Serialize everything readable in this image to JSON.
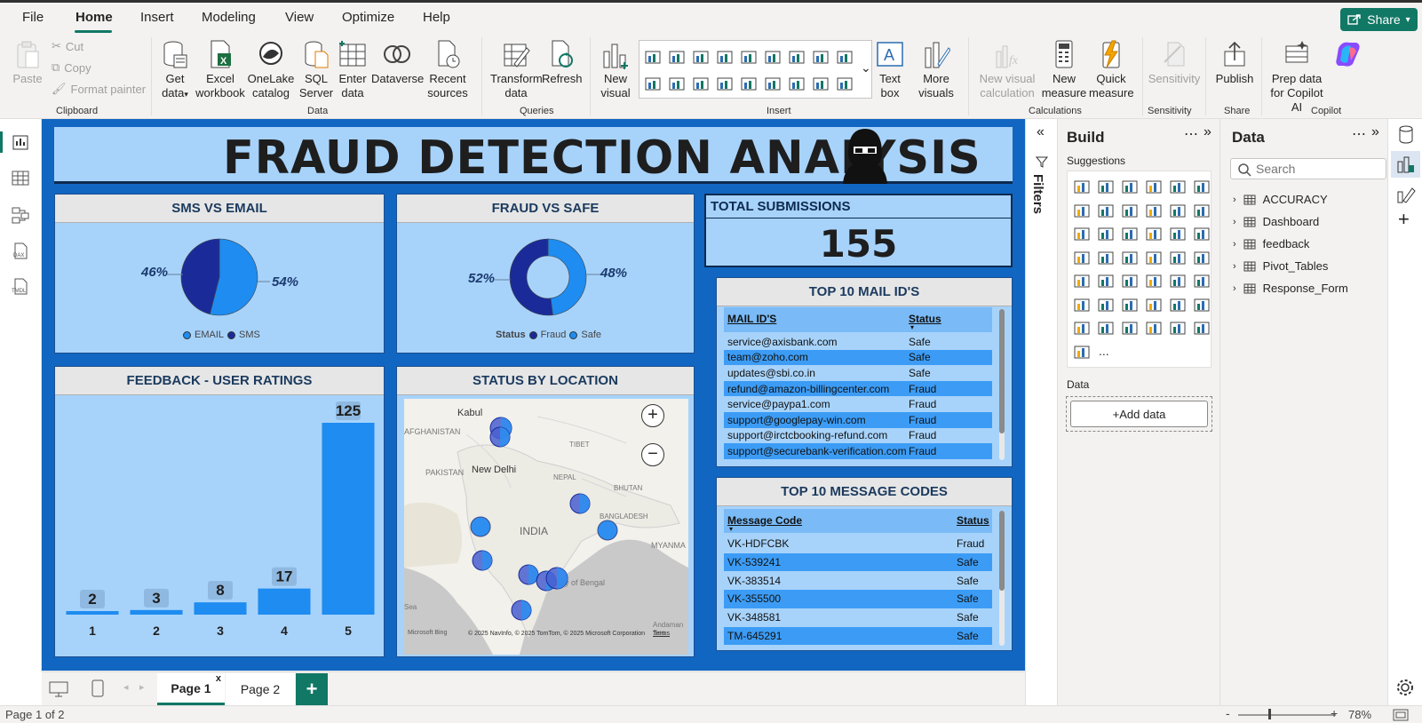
{
  "menu": {
    "items": [
      "File",
      "Home",
      "Insert",
      "Modeling",
      "View",
      "Optimize",
      "Help"
    ],
    "share": "Share"
  },
  "ribbon": {
    "clipboard": {
      "paste": "Paste",
      "cut": "Cut",
      "copy": "Copy",
      "format_painter": "Format painter",
      "group": "Clipboard"
    },
    "data": {
      "get_data": "Get data",
      "excel": "Excel workbook",
      "onelake": "OneLake catalog",
      "sql": "SQL Server",
      "enter_data": "Enter data",
      "dataverse": "Dataverse",
      "recent": "Recent sources",
      "group": "Data"
    },
    "queries": {
      "transform": "Transform data",
      "refresh": "Refresh",
      "group": "Queries"
    },
    "insert": {
      "new_visual": "New visual",
      "text_box": "Text box",
      "more_visuals": "More visuals",
      "group": "Insert"
    },
    "calculations": {
      "new_visual_calc": "New visual calculation",
      "new_measure": "New measure",
      "quick_measure": "Quick measure",
      "group": "Calculations"
    },
    "sensitivity": {
      "label": "Sensitivity",
      "group": "Sensitivity"
    },
    "share": {
      "publish": "Publish",
      "group": "Share"
    },
    "copilot": {
      "prep": "Prep data for Copilot AI",
      "group": "Copilot"
    }
  },
  "report": {
    "title": "FRAUD DETECTION ANALYSIS",
    "sms_email": {
      "title": "SMS VS EMAIL",
      "email_pct": "46%",
      "sms_pct": "54%",
      "legend": [
        "EMAIL",
        "SMS"
      ],
      "values": {
        "EMAIL": 46,
        "SMS": 54
      }
    },
    "fraud_safe": {
      "title": "FRAUD VS SAFE",
      "fraud_pct": "52%",
      "safe_pct": "48%",
      "legend_title": "Status",
      "legend": [
        "Fraud",
        "Safe"
      ],
      "values": {
        "Fraud": 52,
        "Safe": 48
      }
    },
    "total": {
      "title": "TOTAL SUBMISSIONS",
      "value": "155"
    },
    "mail_ids": {
      "title": "TOP 10 MAIL ID'S",
      "headers": [
        "MAIL ID'S",
        "Status"
      ],
      "rows": [
        [
          "service@axisbank.com",
          "Safe"
        ],
        [
          "team@zoho.com",
          "Safe"
        ],
        [
          "updates@sbi.co.in",
          "Safe"
        ],
        [
          "refund@amazon-billingcenter.com",
          "Fraud"
        ],
        [
          "service@paypa1.com",
          "Fraud"
        ],
        [
          "support@googlepay-win.com",
          "Fraud"
        ],
        [
          "support@irctcbooking-refund.com",
          "Fraud"
        ],
        [
          "support@securebank-verification.com",
          "Fraud"
        ]
      ]
    },
    "message_codes": {
      "title": "TOP 10 MESSAGE CODES",
      "headers": [
        "Message Code",
        "Status"
      ],
      "rows": [
        [
          "VK-HDFCBK",
          "Fraud"
        ],
        [
          "VK-539241",
          "Safe"
        ],
        [
          "VK-383514",
          "Safe"
        ],
        [
          "VK-355500",
          "Safe"
        ],
        [
          "VK-348581",
          "Safe"
        ],
        [
          "TM-645291",
          "Safe"
        ]
      ]
    },
    "map": {
      "title": "STATUS BY LOCATION",
      "labels": [
        "Kabul",
        "AFGHANISTAN",
        "TIBET",
        "PAKISTAN",
        "New Delhi",
        "NEPAL",
        "BHUTAN",
        "INDIA",
        "BANGLADESH",
        "MYANMA",
        "Bay of Bengal",
        "Andaman Sea",
        "Sea"
      ],
      "credit": "© 2025 NavInfo, © 2025 TomTom, © 2025 Microsoft Corporation",
      "terms": "Terms",
      "bing": "Microsoft Bing"
    }
  },
  "chart_data": {
    "type": "bar",
    "title": "FEEDBACK - USER RATINGS",
    "categories": [
      "1",
      "2",
      "3",
      "4",
      "5"
    ],
    "values": [
      2,
      3,
      8,
      17,
      125
    ],
    "ylim": [
      0,
      125
    ]
  },
  "pages": {
    "tabs": [
      "Page 1",
      "Page 2"
    ],
    "add": "+",
    "status": "Page 1 of 2",
    "zoom": "78%"
  },
  "filters": {
    "label": "Filters"
  },
  "build": {
    "title": "Build",
    "suggestions": "Suggestions",
    "data_label": "Data",
    "add_data": "+Add data",
    "more": "..."
  },
  "datapane": {
    "title": "Data",
    "search_placeholder": "Search",
    "tables": [
      "ACCURACY",
      "Dashboard",
      "feedback",
      "Pivot_Tables",
      "Response_Form"
    ]
  },
  "colors": {
    "brand": "#117865",
    "report_bg": "#1166c2",
    "panel": "#a7d3fb",
    "bar": "#1e8cf0",
    "dark_blue": "#1a2b99"
  }
}
